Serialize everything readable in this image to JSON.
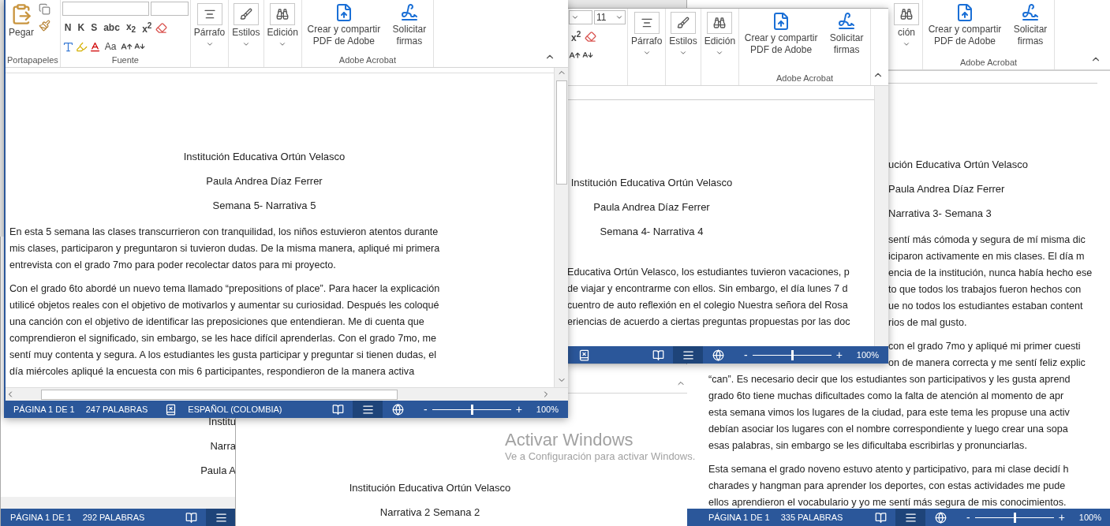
{
  "right_window": {
    "ribbon_groups": [
      {
        "kind": "commands",
        "buttons": [
          {
            "kind": "editing",
            "label": "ción"
          }
        ]
      },
      {
        "kind": "acrobat",
        "label": "Adobe Acrobat",
        "buttons": [
          {
            "kind": "pdf",
            "label": "Crear y compartir PDF de Adobe"
          },
          {
            "kind": "sign",
            "label": "Solicitar firmas"
          }
        ]
      }
    ],
    "headings": [
      "ución Educativa Ortún Velasco",
      "Paula Andrea Díaz Ferrer",
      "Narrativa 3- Semana 3"
    ],
    "paragraphs": [
      {
        "lines": [
          "sentí más cómoda y segura de mí misma dic",
          "iciparon activamente en mis clases. El día m",
          "encia de la institución, nunca había hecho ese",
          "to que todos los trabajos fueron hechos con",
          "ue no todos los estudiantes estaban content",
          "rios de mal gusto."
        ]
      },
      {
        "lines": [
          "con el grado 7mo y apliqué mi primer cuesti",
          "on de manera correcta y me sentí feliz explic",
          "“can”. Es necesario decir que los estudiantes son participativos y les gusta aprend",
          "grado 6to tiene muchas dificultades como la falta de atención al momento de apr",
          "esta semana vimos los lugares de la ciudad, para este tema les propuse una activ",
          "debían asociar los lugares con el nombre correspondiente y luego crear una sopa",
          "esas palabras, sin embargo se les dificultaba escribirlas y pronunciarlas."
        ]
      },
      {
        "lines": [
          "Esta semana el grado noveno estuvo atento y participativo, para mi clase decidí h",
          "charades y hangman para aprender los deportes, con estas actividades me pude",
          "ellos aprendieron el vocabulario y yo me sentí más segura de mis conocimientos."
        ]
      }
    ],
    "status_bar": {
      "page": "PÁGINA 1 DE 1",
      "words": "335 PALABRAS",
      "views": [
        {
          "kind": "read",
          "selected": false
        },
        {
          "kind": "print",
          "selected": true
        },
        {
          "kind": "web",
          "selected": false
        }
      ],
      "zoom": {
        "minus": "-",
        "level": 0.5,
        "plus": "+",
        "reading": "100%"
      }
    }
  },
  "activation_notice": {
    "title": "Activar Windows",
    "hint": "Ve a Configuración para activar Windows."
  },
  "bottom_left_window": {
    "headings": [
      "Institu",
      "Narra",
      "Paula A"
    ],
    "status_bar": {
      "page": "PÁGINA 1 DE 1",
      "words": "292 PALABRAS",
      "views": [
        {
          "kind": "read",
          "selected": false
        },
        {
          "kind": "print",
          "selected": true
        }
      ]
    }
  },
  "bottom_middle_window": {
    "headings": [
      "Institución Educativa Ortún Velasco",
      "Narrativa 2 Semana 2"
    ]
  },
  "middle_window": {
    "ribbon_groups": [
      {
        "kind": "font_partial",
        "size": "11",
        "format_keys": [
          "x$^{2}$"
        ]
      },
      {
        "kind": "commands",
        "buttons": [
          {
            "kind": "paragraph",
            "label": "Párrafo"
          },
          {
            "kind": "styles",
            "label": "Estilos"
          },
          {
            "kind": "editing",
            "label": "Edición"
          }
        ]
      },
      {
        "kind": "acrobat",
        "label": "Adobe Acrobat",
        "buttons": [
          {
            "kind": "pdf",
            "label": "Crear y compartir PDF de Adobe"
          },
          {
            "kind": "sign",
            "label": "Solicitar firmas"
          }
        ]
      }
    ],
    "headings": [
      "Institución Educativa Ortún Velasco",
      "Paula Andrea Díaz Ferrer",
      "Semana 4- Narrativa 4"
    ],
    "paragraphs": [
      {
        "lines": [
          "Educativa Ortún Velasco, los estudiantes tuvieron vacaciones, p",
          "de viajar y encontrarme con ellos. Sin embargo, el día lunes 7 d",
          "cuentro de auto reflexión en el colegio Nuestra señora del Rosa",
          "eriencias de acuerdo a ciertas preguntas propuestas por las doc"
        ]
      }
    ],
    "status_bar": {
      "proofing": true,
      "views": [
        {
          "kind": "read",
          "selected": false
        },
        {
          "kind": "print",
          "selected": true
        },
        {
          "kind": "web",
          "selected": false
        }
      ],
      "zoom": {
        "minus": "-",
        "level": 0.5,
        "plus": "+",
        "reading": "100%"
      }
    }
  },
  "front_window": {
    "ribbon_groups": [
      {
        "kind": "clipboard",
        "label": "Portapapeles",
        "buttons": [
          {
            "kind": "paste",
            "label": "Pegar"
          }
        ]
      },
      {
        "kind": "font",
        "label": "Fuente",
        "format_keys": [
          "N",
          "K",
          "S",
          "abc",
          "x$_{2}$",
          "x$^{2}$"
        ],
        "case_key": "Aa"
      },
      {
        "kind": "commands",
        "buttons": [
          {
            "kind": "paragraph",
            "label": "Párrafo"
          },
          {
            "kind": "styles",
            "label": "Estilos"
          },
          {
            "kind": "editing",
            "label": "Edición"
          }
        ]
      },
      {
        "kind": "acrobat",
        "label": "Adobe Acrobat",
        "buttons": [
          {
            "kind": "pdf",
            "label": "Crear y compartir PDF de Adobe"
          },
          {
            "kind": "sign",
            "label": "Solicitar firmas"
          }
        ]
      }
    ],
    "headings": [
      "Institución Educativa Ortún Velasco",
      "Paula Andrea Díaz Ferrer",
      "Semana 5- Narrativa 5"
    ],
    "paragraphs": [
      {
        "lines": [
          "En esta 5 semana las clases transcurrieron con tranquilidad, los niños estuvieron atentos durante",
          "mis clases, participaron y preguntaron si tuvieron dudas. De la misma manera, apliqué mi primera",
          "entrevista con el grado 7mo para poder recolectar datos para mi proyecto."
        ]
      },
      {
        "lines": [
          "Con el grado 6to abordé un nuevo tema llamado “prepositions of place”. Para hacer la explicación",
          "utilicé objetos reales con el objetivo de motivarlos y aumentar su curiosidad. Después les coloqué",
          "una canción con el objetivo de identificar las preposiciones que entendieran. Me di cuenta que",
          "comprendieron el significado, sin embargo, se les hace difícil aprenderlas. Con el grado 7mo, me",
          "sentí muy contenta y segura. A los estudiantes les gusta participar y preguntar si tienen dudas, el",
          "día miércoles apliqué la encuesta con mis 6 participantes, respondieron de la manera activa"
        ]
      }
    ],
    "status_bar": {
      "page": "PÁGINA 1 DE 1",
      "words": "247 PALABRAS",
      "proofing": true,
      "language": "ESPAÑOL (COLOMBIA)",
      "views": [
        {
          "kind": "read",
          "selected": false
        },
        {
          "kind": "print",
          "selected": true
        },
        {
          "kind": "web",
          "selected": false
        }
      ],
      "zoom": {
        "minus": "-",
        "level": 0.5,
        "plus": "+",
        "reading": "100%"
      }
    }
  }
}
